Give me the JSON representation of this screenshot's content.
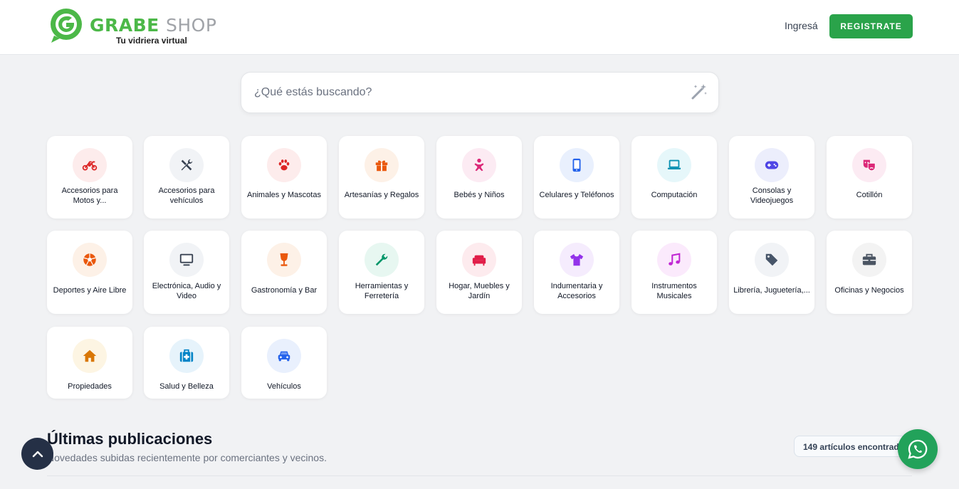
{
  "header": {
    "logo": {
      "brand_a": "GRABE",
      "brand_b": "SHOP",
      "tagline": "Tu vidriera virtual"
    },
    "login_label": "Ingresá",
    "register_label": "REGISTRATE"
  },
  "search": {
    "placeholder": "¿Qué estás buscando?",
    "icon": "magic-wand-icon"
  },
  "categories": [
    {
      "label": "Accesorios para Motos y...",
      "icon": "motorcycle-icon",
      "color": "#dc2626",
      "bg": "#fdecec"
    },
    {
      "label": "Accesorios para vehículos",
      "icon": "tools-icon",
      "color": "#374151",
      "bg": "#f1f3f6"
    },
    {
      "label": "Animales y Mascotas",
      "icon": "paw-icon",
      "color": "#dc2626",
      "bg": "#fdecec"
    },
    {
      "label": "Artesanías y Regalos",
      "icon": "gift-icon",
      "color": "#ea580c",
      "bg": "#fdf1e7"
    },
    {
      "label": "Bebés y Niños",
      "icon": "baby-icon",
      "color": "#db2777",
      "bg": "#fcebf3"
    },
    {
      "label": "Celulares y Teléfonos",
      "icon": "phone-icon",
      "color": "#2563eb",
      "bg": "#e9f0fd"
    },
    {
      "label": "Computación",
      "icon": "laptop-icon",
      "color": "#0891b2",
      "bg": "#e6f7fa"
    },
    {
      "label": "Consolas y Videojuegos",
      "icon": "gamepad-icon",
      "color": "#4f46e5",
      "bg": "#eceefc"
    },
    {
      "label": "Cotillón",
      "icon": "masks-icon",
      "color": "#db2777",
      "bg": "#fcebf3"
    },
    {
      "label": "Deportes y Aire Libre",
      "icon": "ball-icon",
      "color": "#ea580c",
      "bg": "#fdf1e7"
    },
    {
      "label": "Electrónica, Audio y Video",
      "icon": "tv-icon",
      "color": "#374151",
      "bg": "#f1f3f6"
    },
    {
      "label": "Gastronomía y Bar",
      "icon": "wine-glass-icon",
      "color": "#ea580c",
      "bg": "#fdf1e7"
    },
    {
      "label": "Herramientas y Ferretería",
      "icon": "wrench-icon",
      "color": "#059669",
      "bg": "#e7f7f1"
    },
    {
      "label": "Hogar, Muebles y Jardín",
      "icon": "couch-icon",
      "color": "#e11d48",
      "bg": "#fdebee"
    },
    {
      "label": "Indumentaria y Accesorios",
      "icon": "tshirt-icon",
      "color": "#9333ea",
      "bg": "#f5ecfd"
    },
    {
      "label": "Instrumentos Musicales",
      "icon": "music-icon",
      "color": "#c026d3",
      "bg": "#fbeafc"
    },
    {
      "label": "Librería, Juguetería,...",
      "icon": "tag-icon",
      "color": "#475569",
      "bg": "#f1f3f6"
    },
    {
      "label": "Oficinas y Negocios",
      "icon": "briefcase-icon",
      "color": "#4b5563",
      "bg": "#f3f3f3"
    },
    {
      "label": "Propiedades",
      "icon": "house-icon",
      "color": "#d97706",
      "bg": "#fdf5e3"
    },
    {
      "label": "Salud y Belleza",
      "icon": "medkit-icon",
      "color": "#0284c7",
      "bg": "#e6f3fb"
    },
    {
      "label": "Vehículos",
      "icon": "car-icon",
      "color": "#2563eb",
      "bg": "#e9f0fd"
    }
  ],
  "latest": {
    "title": "Últimas publicaciones",
    "subtitle": "Novedades subidas recientemente por comerciantes y vecinos.",
    "count_label": "149 artículos encontrados"
  },
  "floating": {
    "scroll_top_icon": "chevron-up-icon",
    "whatsapp_icon": "whatsapp-icon"
  }
}
